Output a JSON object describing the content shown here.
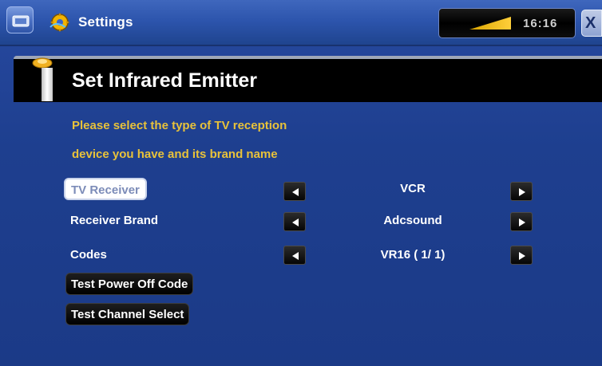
{
  "topbar": {
    "app_title": "Settings",
    "clock": "16:16",
    "battery_icon": "battery-level-icon",
    "home_icon": "home-icon",
    "app_icon": "settings-icon",
    "close_label": "X"
  },
  "panel": {
    "title": "Set Infrared Emitter"
  },
  "instructions": {
    "line1": "Please select the type of TV reception",
    "line2": "device you have and its brand name"
  },
  "rows": {
    "device": {
      "label": "TV Receiver",
      "value": "VCR",
      "selected": true
    },
    "brand": {
      "label": "Receiver Brand",
      "value": "Adcsound"
    },
    "codes": {
      "label": "Codes",
      "value": "VR16 ( 1/ 1)"
    }
  },
  "actions": {
    "power_off": "Test Power Off Code",
    "channel_select": "Test Channel Select"
  },
  "colors": {
    "background": "#1f3d86",
    "instruction_text": "#e8c23a",
    "header_band": "#000000",
    "battery_fill": "#f0a020"
  }
}
